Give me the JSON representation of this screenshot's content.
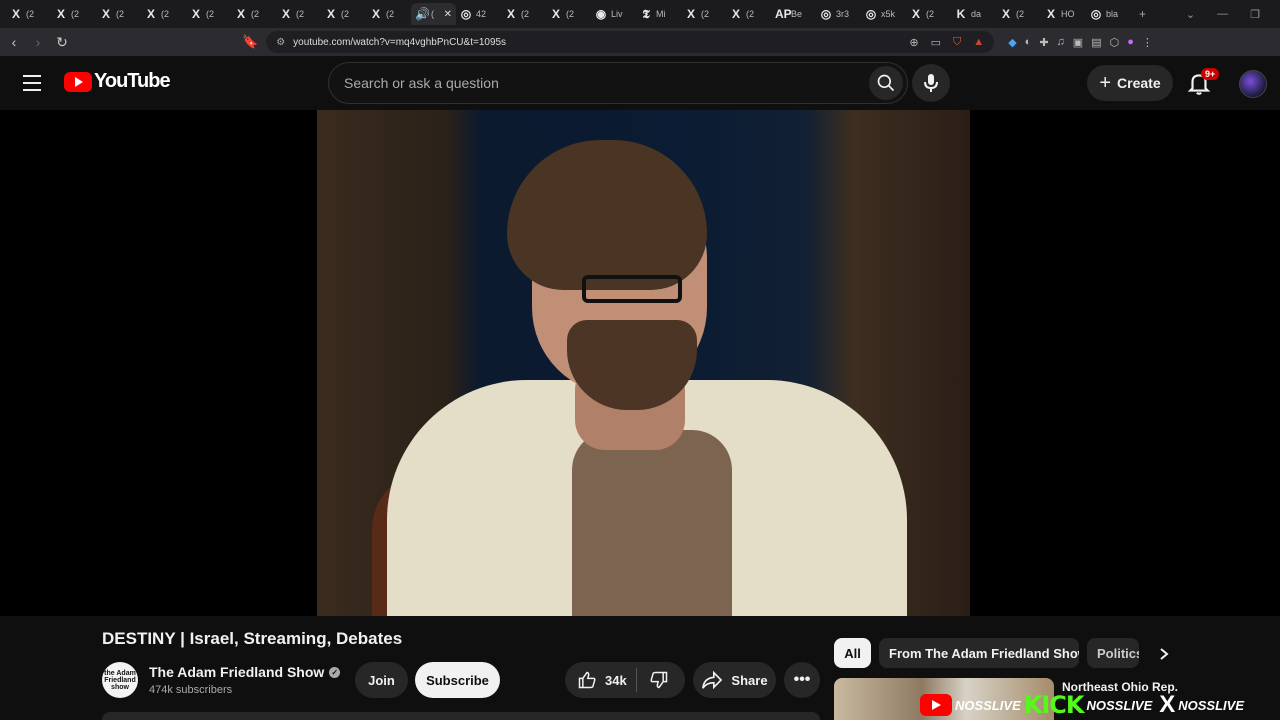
{
  "browser": {
    "tabs": [
      {
        "icon": "X",
        "label": "(2"
      },
      {
        "icon": "X",
        "label": "(2"
      },
      {
        "icon": "X",
        "label": "(2"
      },
      {
        "icon": "X",
        "label": "(2"
      },
      {
        "icon": "X",
        "label": "(2"
      },
      {
        "icon": "X",
        "label": "(2"
      },
      {
        "icon": "X",
        "label": "(2"
      },
      {
        "icon": "X",
        "label": "(2"
      },
      {
        "icon": "X",
        "label": "(2"
      },
      {
        "icon": "🔊",
        "label": "(",
        "active": true,
        "close": "✕"
      },
      {
        "icon": "◎",
        "label": "42"
      },
      {
        "icon": "X",
        "label": "(2"
      },
      {
        "icon": "X",
        "label": "(2"
      },
      {
        "icon": "◉",
        "label": "Liv"
      },
      {
        "icon": "𝕿",
        "label": "Mi"
      },
      {
        "icon": "X",
        "label": "(2"
      },
      {
        "icon": "X",
        "label": "(2"
      },
      {
        "icon": "AP",
        "label": "Be"
      },
      {
        "icon": "◎",
        "label": "3r3"
      },
      {
        "icon": "◎",
        "label": "x5k"
      },
      {
        "icon": "X",
        "label": "(2"
      },
      {
        "icon": "K",
        "label": "da"
      },
      {
        "icon": "X",
        "label": "(2"
      },
      {
        "icon": "X",
        "label": "HO"
      },
      {
        "icon": "◎",
        "label": "bla"
      }
    ],
    "new_tab": "+",
    "window_controls": [
      "⌄",
      "—",
      "❐"
    ],
    "url": "youtube.com/watch?v=mq4vghbPnCU&t=1095s"
  },
  "header": {
    "logo_text": "YouTube",
    "search_placeholder": "Search or ask a question",
    "create_label": "Create",
    "notification_badge": "9+"
  },
  "video": {
    "title": "DESTINY | Israel, Streaming, Debates",
    "channel_name": "The Adam Friedland Show",
    "channel_avatar_text": "the Adam Friedland show",
    "subscribers": "474k subscribers",
    "join_label": "Join",
    "subscribe_label": "Subscribe",
    "likes": "34k",
    "share_label": "Share"
  },
  "chips": {
    "all": "All",
    "from_channel": "From The Adam Friedland Show",
    "politics": "Politics"
  },
  "recommendation": {
    "title": "Northeast Ohio Rep."
  },
  "overlay": {
    "handle1": "NOSSLIVE",
    "kick": "KICK",
    "handle2": "NOSSLIVE",
    "x": "X",
    "handle3": "NOSSLIVE"
  },
  "colors": {
    "brand_red": "#ff0000",
    "kick_green": "#53fc18",
    "background": "#0f0f0f"
  }
}
